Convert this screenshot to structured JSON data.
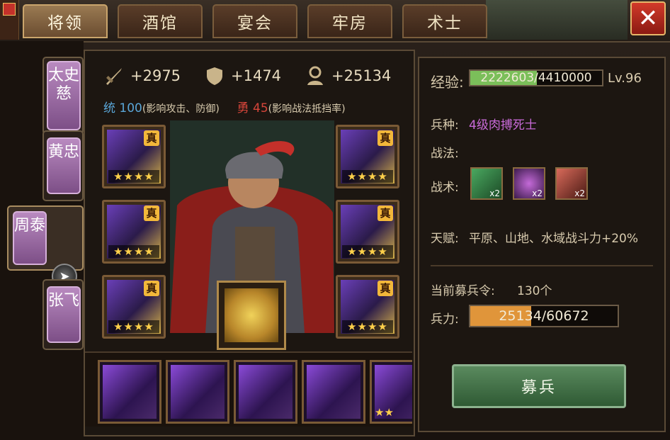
{
  "tabs": [
    "将领",
    "酒馆",
    "宴会",
    "牢房",
    "术士"
  ],
  "active_tab": 0,
  "close_label": "✕",
  "heroes": [
    {
      "name": "太史慈",
      "active": false
    },
    {
      "name": "黄忠",
      "active": false
    },
    {
      "name": "周泰",
      "active": true
    },
    {
      "name": "张飞",
      "active": false
    }
  ],
  "stats": {
    "attack": "+2975",
    "defense": "+1474",
    "troops": "+25134",
    "leadership_label": "统",
    "leadership_value": "100",
    "leadership_note": "(影响攻击、防御)",
    "courage_label": "勇",
    "courage_value": "45",
    "courage_note": "(影响战法抵挡率)"
  },
  "equipment": {
    "badge": "真",
    "stars": "★★★★"
  },
  "beasts_stars": "★★",
  "info": {
    "exp_label": "经验:",
    "exp_text": "2222603/4410000",
    "exp_fraction": 0.504,
    "level": "Lv.96",
    "troop_type_label": "兵种:",
    "troop_type": "4级肉搏死士",
    "tactic_label": "战法:",
    "skill_label": "战术:",
    "skills": [
      {
        "icon": "green-gem-icon",
        "count": "x2"
      },
      {
        "icon": "purple-orb-icon",
        "count": "x2"
      },
      {
        "icon": "red-scroll-icon",
        "count": "x2"
      }
    ],
    "talent_label": "天赋:",
    "talent_text": "平原、山地、水域战斗力+20%",
    "recruit_tokens_label": "当前募兵令:",
    "recruit_tokens": "130个",
    "force_label": "兵力:",
    "force_text": "25134/60672",
    "force_fraction": 0.414,
    "recruit_button": "募兵"
  },
  "colors": {
    "exp_fill": "#7bbf5a",
    "force_fill": "#e0953a",
    "troop_type": "#c86ad8",
    "leadership": "#5aa6d8",
    "courage": "#d6453a"
  }
}
